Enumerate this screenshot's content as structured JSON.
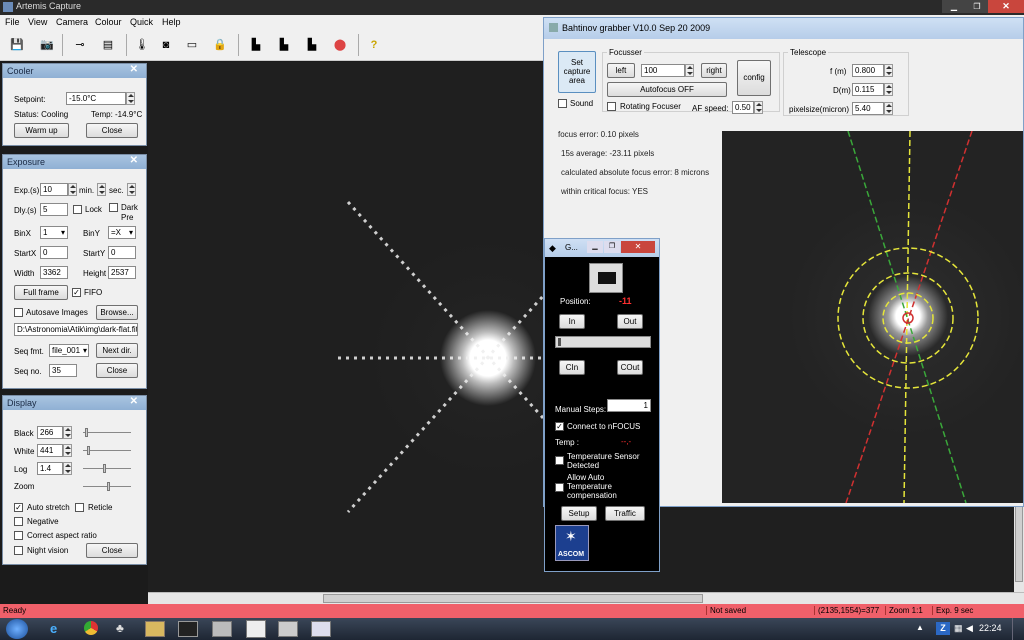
{
  "app": {
    "title": "Artemis Capture"
  },
  "menu": [
    "File",
    "View",
    "Camera",
    "Colour",
    "Quick",
    "Help"
  ],
  "cooler": {
    "title": "Cooler",
    "setpoint_label": "Setpoint:",
    "setpoint_value": "-15.0°C",
    "status": "Status: Cooling",
    "temp": "Temp: -14.9°C",
    "warm_up": "Warm up",
    "close": "Close"
  },
  "exposure": {
    "title": "Exposure",
    "exp_label": "Exp.(s)",
    "exp_value": "10",
    "min_label": "min.",
    "sec_label": "sec.",
    "dly_label": "Dly.(s)",
    "dly_value": "5",
    "lock_label": "Lock",
    "dark_label": "Dark",
    "pre_label": "Pre",
    "binx_label": "BinX",
    "binx_value": "1",
    "biny_label": "BinY",
    "biny_value": "=X",
    "startx_label": "StartX",
    "startx_value": "0",
    "starty_label": "StartY",
    "starty_value": "0",
    "width_label": "Width",
    "width_value": "3362",
    "height_label": "Height",
    "height_value": "2537",
    "full_frame": "Full frame",
    "fifo_label": "FIFO",
    "autosave_label": "Autosave Images",
    "browse": "Browse...",
    "path_value": "D:\\Astronomia\\Atik\\img\\dark-flat.fit",
    "seqfmt_label": "Seq fmt.",
    "seqfmt_value": "file_001",
    "next_dir": "Next dir.",
    "seqno_label": "Seq no.",
    "seqno_value": "35",
    "close": "Close"
  },
  "display": {
    "title": "Display",
    "black_label": "Black",
    "black_value": "266",
    "white_label": "White",
    "white_value": "441",
    "log_label": "Log",
    "log_value": "1.4",
    "zoom_label": "Zoom",
    "auto_stretch": "Auto stretch",
    "reticle": "Reticle",
    "negative": "Negative",
    "aspect": "Correct aspect ratio",
    "night": "Night vision",
    "close": "Close"
  },
  "bahtinov": {
    "title": "Bahtinov grabber  V10.0 Sep 20 2009",
    "set_capture": "Set capture area",
    "sound": "Sound",
    "focusser_label": "Focusser",
    "left": "left",
    "right": "right",
    "step_value": "100",
    "autofocus": "Autofocus OFF",
    "rotating": "Rotating Focuser",
    "af_speed_label": "AF speed:",
    "af_speed_value": "0.50",
    "config": "config",
    "telescope_label": "Telescope",
    "f_label": "f (m)",
    "f_value": "0.800",
    "d_label": "D(m)",
    "d_value": "0.115",
    "pix_label": "pixelsize(micron)",
    "pix_value": "5.40",
    "focus_error": "focus error: 0.10 pixels",
    "average": "15s average: -23.11 pixels",
    "abs_error": "calculated absolute focus error: 8 microns",
    "critical": "within critical focus: YES"
  },
  "nfocus": {
    "title": "G...",
    "position_label": "Position:",
    "position_value": "-11",
    "in": "In",
    "out": "Out",
    "cin": "CIn",
    "cout": "COut",
    "manual_steps_label": "Manual Steps:",
    "manual_steps_value": "1",
    "connect": "Connect to nFOCUS",
    "temp_label": "Temp :",
    "temp_value": "--,-",
    "temp_sensor": "Temperature Sensor Detected",
    "allow_auto": "Allow Auto Temperature compensation",
    "setup": "Setup",
    "traffic": "Traffic",
    "ascom": "ASCOM"
  },
  "status": {
    "ready": "Ready",
    "saved": "Not saved",
    "coords": "(2135,1554)=377",
    "zoom": "Zoom 1:1",
    "exp": "Exp. 9 sec"
  },
  "taskbar": {
    "clock": "22:24"
  },
  "colors": {
    "status_bar": "#f0606a",
    "ascom_blue": "#1c3f8f",
    "title_blue": "#a9c4e0"
  }
}
